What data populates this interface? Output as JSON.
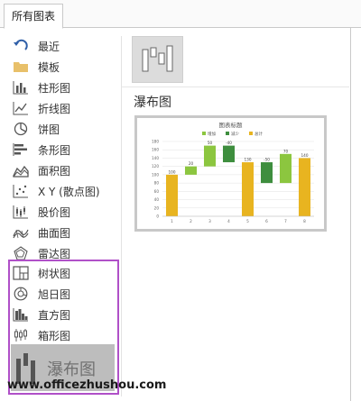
{
  "tabs": [
    {
      "label": "所有图表"
    }
  ],
  "sidebar": {
    "items": [
      {
        "label": "最近",
        "icon": "recent-icon"
      },
      {
        "label": "模板",
        "icon": "folder-icon"
      },
      {
        "label": "柱形图",
        "icon": "column-chart-icon"
      },
      {
        "label": "折线图",
        "icon": "line-chart-icon"
      },
      {
        "label": "饼图",
        "icon": "pie-chart-icon"
      },
      {
        "label": "条形图",
        "icon": "bar-chart-icon"
      },
      {
        "label": "面积图",
        "icon": "area-chart-icon"
      },
      {
        "label": "X Y (散点图)",
        "icon": "scatter-chart-icon"
      },
      {
        "label": "股价图",
        "icon": "stock-chart-icon"
      },
      {
        "label": "曲面图",
        "icon": "surface-chart-icon"
      },
      {
        "label": "雷达图",
        "icon": "radar-chart-icon"
      },
      {
        "label": "树状图",
        "icon": "treemap-chart-icon"
      },
      {
        "label": "旭日图",
        "icon": "sunburst-chart-icon"
      },
      {
        "label": "直方图",
        "icon": "histogram-chart-icon"
      },
      {
        "label": "箱形图",
        "icon": "boxwhisker-chart-icon"
      }
    ],
    "selected": {
      "label": "瀑布图",
      "icon": "waterfall-chart-icon"
    }
  },
  "main": {
    "section_title": "瀑布图"
  },
  "chart_data": {
    "type": "bar",
    "subtype": "waterfall",
    "title": "图表标题",
    "legend": [
      "增加",
      "减少",
      "总计"
    ],
    "categories": [
      "1",
      "2",
      "3",
      "4",
      "5",
      "6",
      "7",
      "8"
    ],
    "values": [
      100,
      20,
      50,
      -40,
      130,
      -50,
      70,
      140
    ],
    "value_labels": [
      "100",
      "20",
      "50",
      "-40",
      "130",
      "-50",
      "70",
      "140"
    ],
    "kinds": [
      "total",
      "increase",
      "increase",
      "decrease",
      "total",
      "decrease",
      "increase",
      "total"
    ],
    "ylim": [
      0,
      180
    ],
    "yticks": [
      0,
      20,
      40,
      60,
      80,
      100,
      120,
      140,
      160,
      180
    ],
    "grid": true,
    "legend_position": "top",
    "colors": {
      "increase": "#8cc63f",
      "decrease": "#3e8e3e",
      "total": "#e8b420"
    }
  },
  "watermark": "www.officezhushou.com",
  "accent": "#b050c8"
}
